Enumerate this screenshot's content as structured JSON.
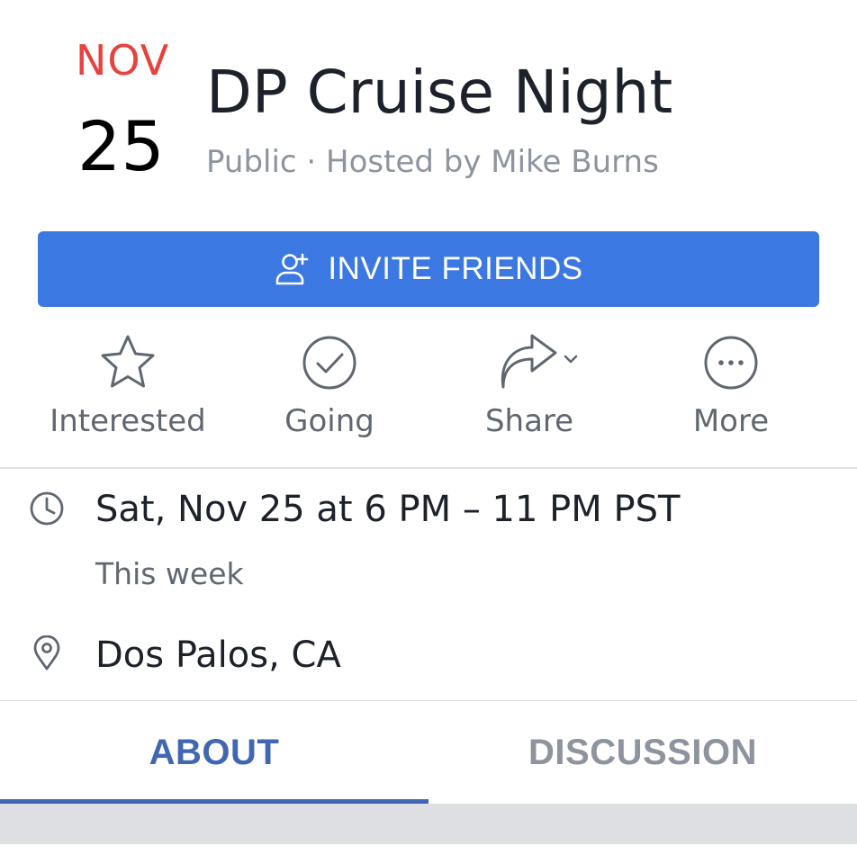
{
  "event": {
    "month": "NOV",
    "day": "25",
    "title": "DP Cruise Night",
    "subtitle": "Public · Hosted by Mike Burns"
  },
  "invite_button": {
    "label": "INVITE FRIENDS",
    "icon": "add-person-icon"
  },
  "actions": [
    {
      "label": "Interested",
      "icon": "star-icon"
    },
    {
      "label": "Going",
      "icon": "check-circle-icon"
    },
    {
      "label": "Share",
      "icon": "share-arrow-icon"
    },
    {
      "label": "More",
      "icon": "more-dots-icon"
    }
  ],
  "details": {
    "time": "Sat, Nov 25 at 6 PM – 11 PM PST",
    "time_sub": "This week",
    "location": "Dos Palos, CA"
  },
  "tabs": [
    {
      "label": "ABOUT",
      "active": true
    },
    {
      "label": "DISCUSSION",
      "active": false
    }
  ],
  "colors": {
    "accent": "#3b78e2",
    "month_red": "#e8423f",
    "tab_active": "#4267b2",
    "tab_inactive": "#8d949e"
  }
}
